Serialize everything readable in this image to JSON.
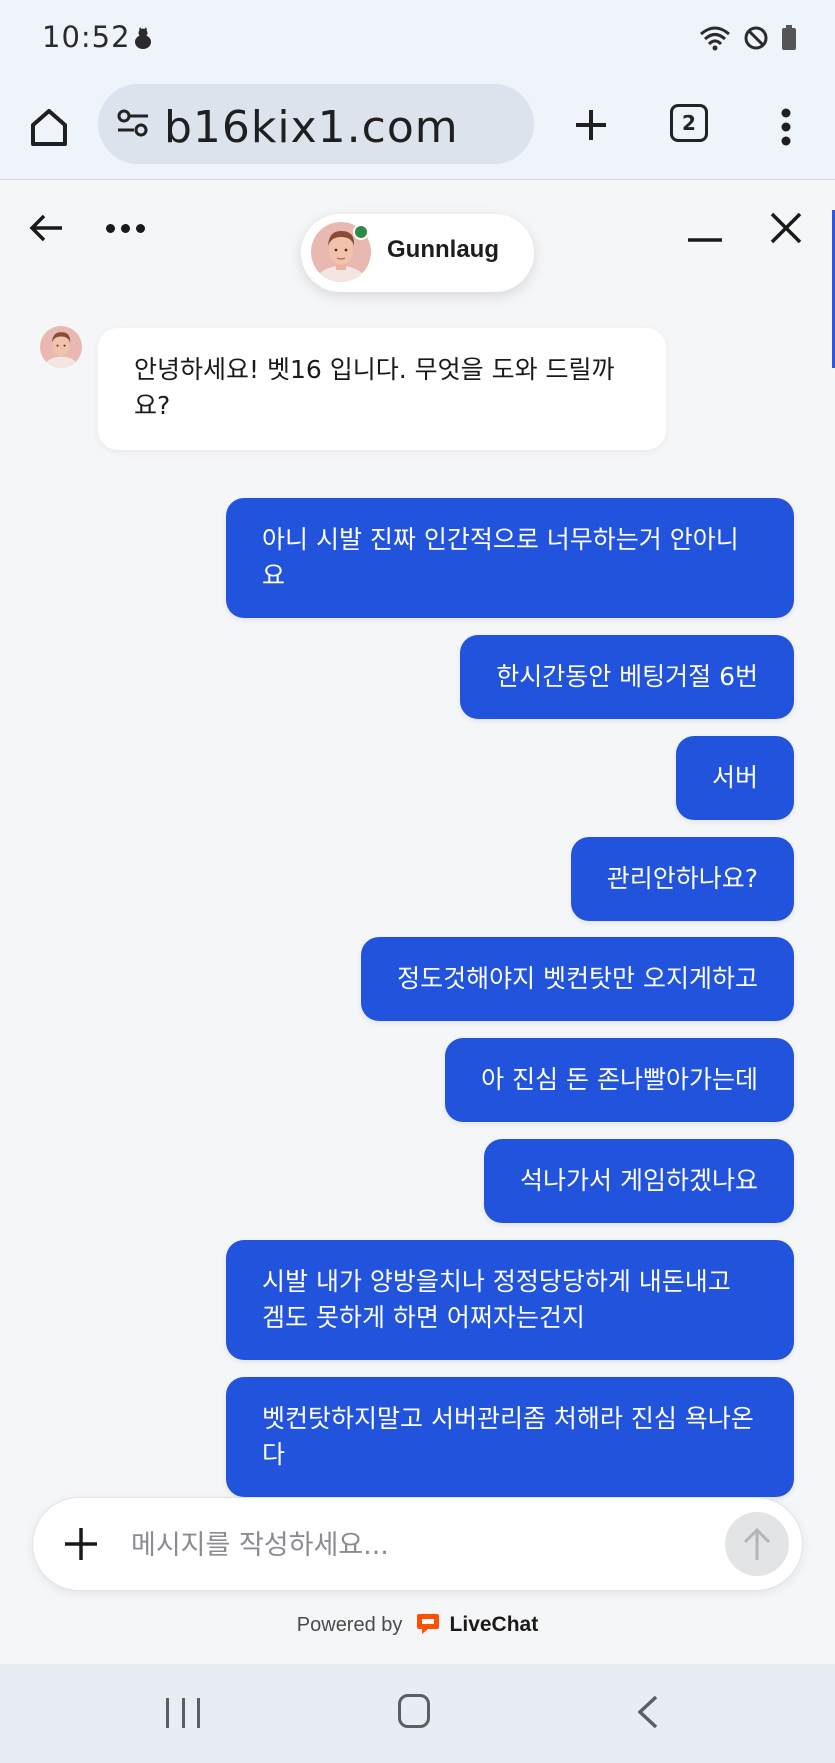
{
  "status_bar": {
    "time": "10:52"
  },
  "browser": {
    "url": "b16kix1.com",
    "tab_count": "2"
  },
  "chat": {
    "agent_name": "Gunnlaug",
    "agent_status": "online",
    "incoming": [
      "안녕하세요! 벳16 입니다. 무엇을 도와 드릴까요?"
    ],
    "outgoing": [
      "아니 시발 진짜 인간적으로 너무하는거 안아니요",
      "한시간동안 베팅거절 6번",
      "서버",
      "관리안하나요?",
      "정도것해야지 벳컨탓만 오지게하고",
      "아 진심 돈 존나빨아가는데",
      "석나가서 게임하겠나요",
      "시발 내가 양방을치나 정정당당하게 내돈내고 겜도 못하게 하면 어쩌자는건지",
      "벳컨탓하지말고 서버관리좀 처해라 진심 욕나온다"
    ]
  },
  "composer": {
    "placeholder": "메시지를 작성하세요..."
  },
  "footer": {
    "powered_by": "Powered by",
    "brand": "LiveChat"
  },
  "colors": {
    "outgoing_bubble": "#2153dd",
    "online_dot": "#2c8a4a",
    "livechat_orange": "#ff5100"
  }
}
